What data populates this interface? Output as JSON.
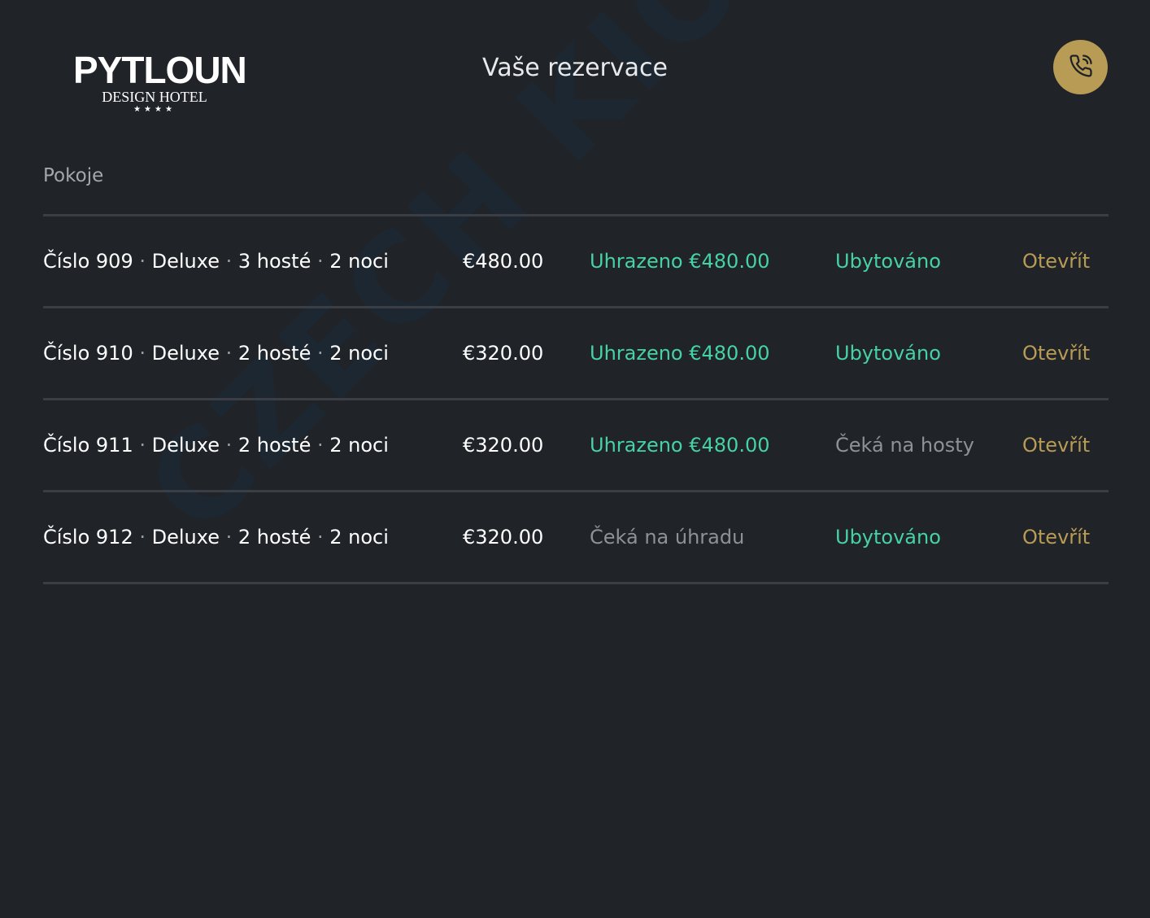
{
  "header": {
    "logo_main": "PYTLOUN",
    "logo_sub": "DESIGN HOTEL",
    "logo_stars": "★★★★",
    "title": "Vaše rezervace",
    "call_icon": "phone-icon"
  },
  "section_label": "Pokoje",
  "watermark": "CZECH KIOSK",
  "colors": {
    "background": "#202328",
    "accent_gold": "#b89b55",
    "status_ok": "#46d2a3",
    "status_waiting": "#8e9297"
  },
  "rooms": [
    {
      "number": "Číslo 909",
      "type": "Deluxe",
      "guests": "3 hosté",
      "nights": "2 noci",
      "price": "€480.00",
      "payment": "Uhrazeno €480.00",
      "payment_state": "ok",
      "stay": "Ubytováno",
      "stay_state": "ok",
      "action": "Otevřít"
    },
    {
      "number": "Číslo 910",
      "type": "Deluxe",
      "guests": "2 hosté",
      "nights": "2 noci",
      "price": "€320.00",
      "payment": "Uhrazeno €480.00",
      "payment_state": "ok",
      "stay": "Ubytováno",
      "stay_state": "ok",
      "action": "Otevřít"
    },
    {
      "number": "Číslo 911",
      "type": "Deluxe",
      "guests": "2 hosté",
      "nights": "2 noci",
      "price": "€320.00",
      "payment": "Uhrazeno €480.00",
      "payment_state": "ok",
      "stay": "Čeká na hosty",
      "stay_state": "wait",
      "action": "Otevřít"
    },
    {
      "number": "Číslo 912",
      "type": "Deluxe",
      "guests": "2 hosté",
      "nights": "2 noci",
      "price": "€320.00",
      "payment": "Čeká na úhradu",
      "payment_state": "wait",
      "stay": "Ubytováno",
      "stay_state": "ok",
      "action": "Otevřít"
    }
  ]
}
